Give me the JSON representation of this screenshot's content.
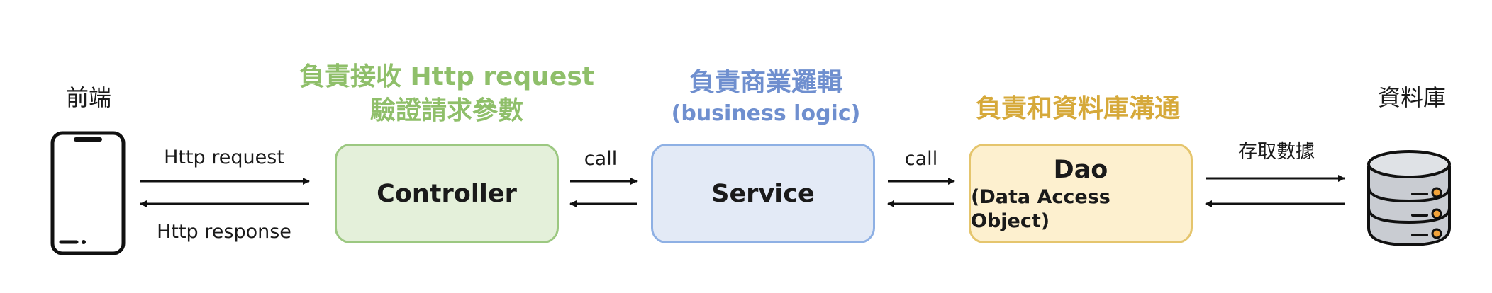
{
  "frontend": {
    "label": "前端",
    "icon": "smartphone-icon"
  },
  "database": {
    "label": "資料庫",
    "icon": "database-icon"
  },
  "controller": {
    "title_line1": "負責接收 Http request",
    "title_line2": "驗證請求參數",
    "box_label": "Controller"
  },
  "service": {
    "title_line1": "負責商業邏輯",
    "title_line2": "(business logic)",
    "box_label": "Service"
  },
  "dao": {
    "title": "負責和資料庫溝通",
    "box_label": "Dao",
    "box_sublabel": "(Data Access Object)"
  },
  "links": {
    "frontend_controller_request": "Http request",
    "frontend_controller_response": "Http response",
    "controller_service": "call",
    "service_dao": "call",
    "dao_database": "存取數據"
  },
  "colors": {
    "controller": "#8fbf6a",
    "service": "#6f8fcf",
    "dao": "#d6a93a"
  }
}
